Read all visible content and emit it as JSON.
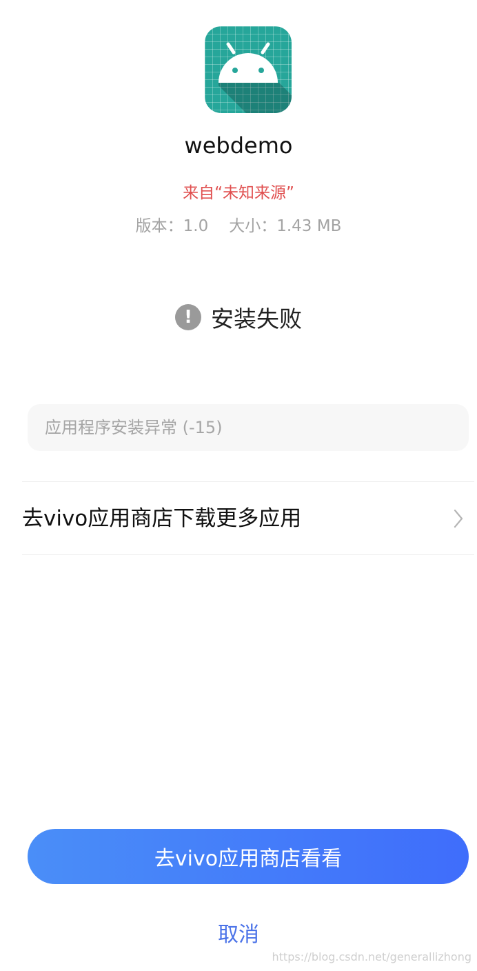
{
  "app": {
    "name": "webdemo",
    "icon": "android-robot-icon",
    "icon_color": "#26a69a"
  },
  "source": {
    "text": "来自“未知来源”",
    "color": "#e05050"
  },
  "meta": {
    "version": "版本：1.0",
    "size": "大小：1.43 MB"
  },
  "status": {
    "icon": "exclamation-icon",
    "text": "安装失败"
  },
  "error": {
    "message": "应用程序安装异常 (-15)"
  },
  "store_row": {
    "label": "去vivo应用商店下载更多应用",
    "icon": "chevron-right-icon"
  },
  "actions": {
    "primary": "去vivo应用商店看看",
    "cancel": "取消",
    "primary_color": "#4a8ef8",
    "cancel_color": "#4a72e8"
  },
  "watermark": "https://blog.csdn.net/generallizhong"
}
